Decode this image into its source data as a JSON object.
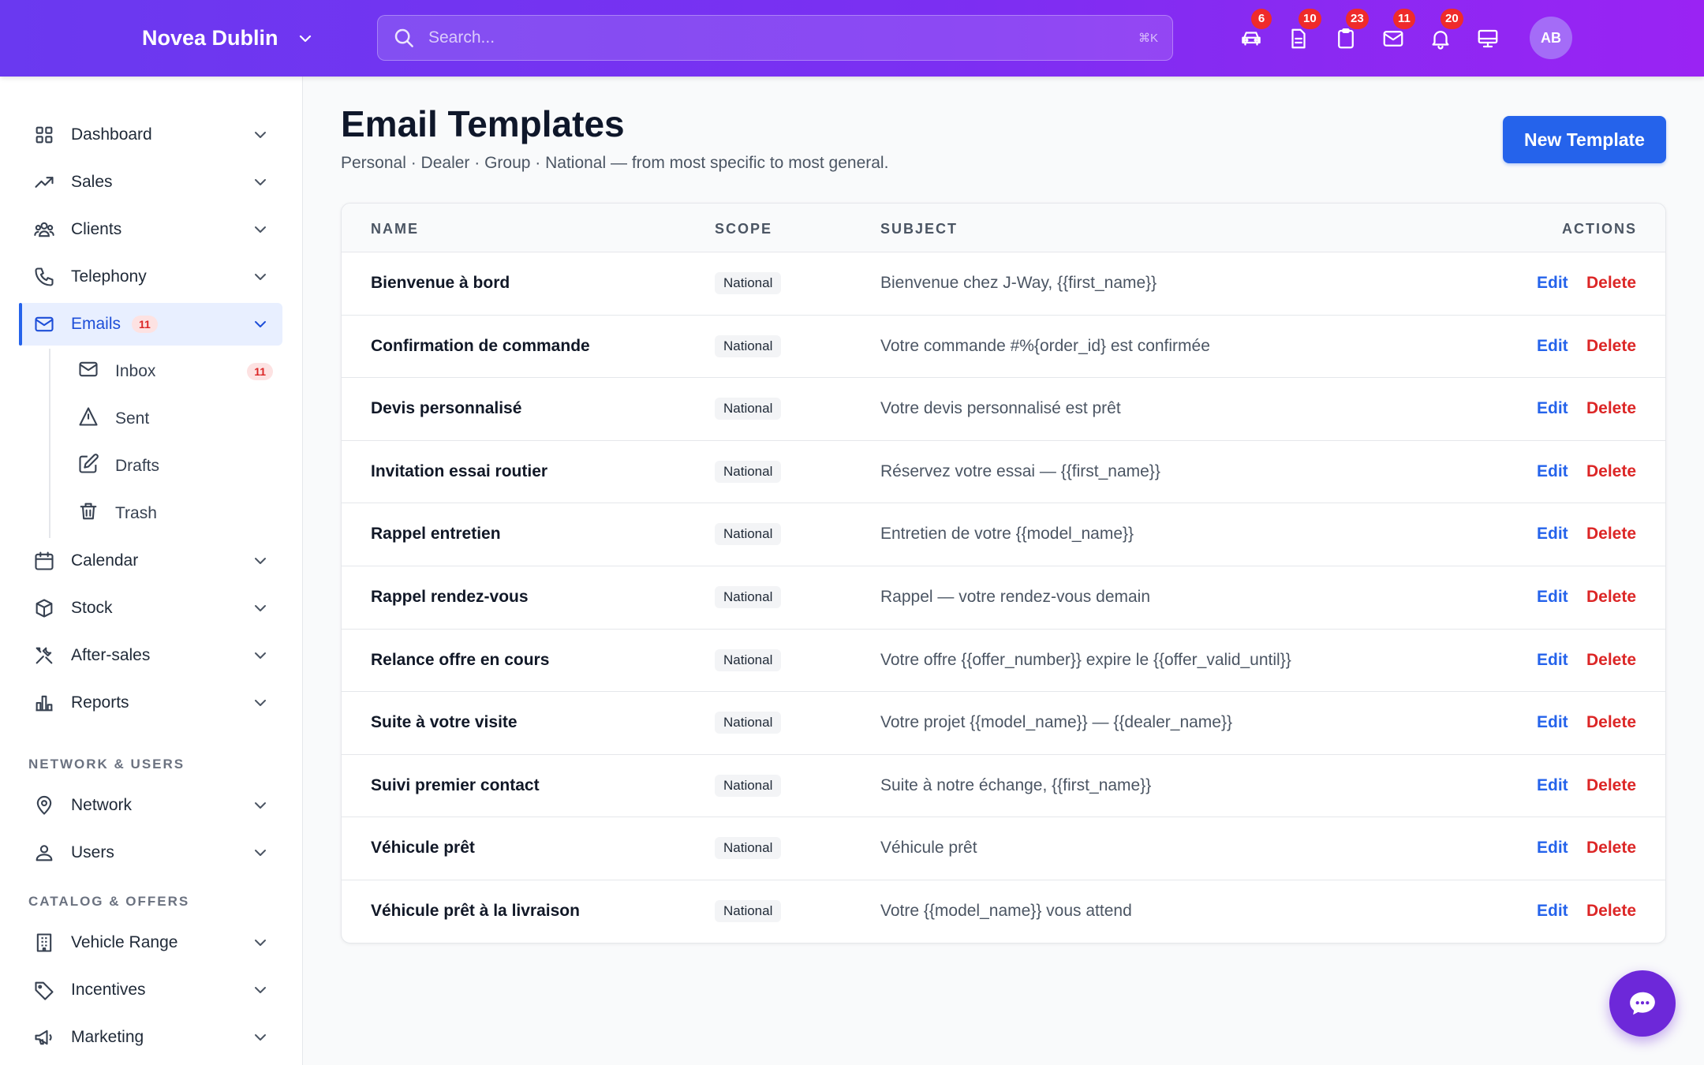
{
  "header": {
    "brand": "Novea Dublin",
    "search_placeholder": "Search...",
    "search_shortcut": "⌘K",
    "icons": [
      {
        "name": "car-icon",
        "badge": "6"
      },
      {
        "name": "document-icon",
        "badge": "10"
      },
      {
        "name": "clipboard-icon",
        "badge": "23"
      },
      {
        "name": "mail-icon",
        "badge": "11"
      },
      {
        "name": "bell-icon",
        "badge": "20"
      },
      {
        "name": "monitor-icon",
        "badge": ""
      }
    ],
    "avatar": "AB"
  },
  "sidebar": {
    "items": [
      {
        "label": "Dashboard",
        "icon": "grid-icon"
      },
      {
        "label": "Sales",
        "icon": "trending-up-icon"
      },
      {
        "label": "Clients",
        "icon": "users-icon"
      },
      {
        "label": "Telephony",
        "icon": "phone-icon"
      },
      {
        "label": "Emails",
        "icon": "mail-icon",
        "count": "11",
        "active": true
      },
      {
        "label": "Calendar",
        "icon": "calendar-icon"
      },
      {
        "label": "Stock",
        "icon": "box-icon"
      },
      {
        "label": "After-sales",
        "icon": "tools-icon"
      },
      {
        "label": "Reports",
        "icon": "chart-icon"
      }
    ],
    "email_sub": [
      {
        "label": "Inbox",
        "icon": "mail-icon",
        "count": "11"
      },
      {
        "label": "Sent",
        "icon": "send-icon"
      },
      {
        "label": "Drafts",
        "icon": "edit-icon"
      },
      {
        "label": "Trash",
        "icon": "trash-icon"
      }
    ],
    "section_network": "NETWORK & USERS",
    "network_items": [
      {
        "label": "Network",
        "icon": "location-icon"
      },
      {
        "label": "Users",
        "icon": "user-icon"
      }
    ],
    "section_catalog": "CATALOG & OFFERS",
    "catalog_items": [
      {
        "label": "Vehicle Range",
        "icon": "building-icon"
      },
      {
        "label": "Incentives",
        "icon": "tag-icon"
      },
      {
        "label": "Marketing",
        "icon": "megaphone-icon"
      }
    ]
  },
  "main": {
    "title": "Email Templates",
    "subtitle": "Personal · Dealer · Group · National — from most specific to most general.",
    "new_button": "New Template",
    "columns": {
      "name": "NAME",
      "scope": "SCOPE",
      "subject": "SUBJECT",
      "actions": "ACTIONS"
    },
    "edit_label": "Edit",
    "delete_label": "Delete",
    "rows": [
      {
        "name": "Bienvenue à bord",
        "scope": "National",
        "subject": "Bienvenue chez J-Way, {{first_name}}"
      },
      {
        "name": "Confirmation de commande",
        "scope": "National",
        "subject": "Votre commande #%{order_id} est confirmée"
      },
      {
        "name": "Devis personnalisé",
        "scope": "National",
        "subject": "Votre devis personnalisé est prêt"
      },
      {
        "name": "Invitation essai routier",
        "scope": "National",
        "subject": "Réservez votre essai — {{first_name}}"
      },
      {
        "name": "Rappel entretien",
        "scope": "National",
        "subject": "Entretien de votre {{model_name}}"
      },
      {
        "name": "Rappel rendez-vous",
        "scope": "National",
        "subject": "Rappel — votre rendez-vous demain"
      },
      {
        "name": "Relance offre en cours",
        "scope": "National",
        "subject": "Votre offre {{offer_number}} expire le {{offer_valid_until}}"
      },
      {
        "name": "Suite à votre visite",
        "scope": "National",
        "subject": "Votre projet {{model_name}} — {{dealer_name}}"
      },
      {
        "name": "Suivi premier contact",
        "scope": "National",
        "subject": "Suite à notre échange, {{first_name}}"
      },
      {
        "name": "Véhicule prêt",
        "scope": "National",
        "subject": "Véhicule prêt"
      },
      {
        "name": "Véhicule prêt à la livraison",
        "scope": "National",
        "subject": "Votre {{model_name}} vous attend"
      }
    ]
  },
  "chat_fab_icon": "chat-icon"
}
